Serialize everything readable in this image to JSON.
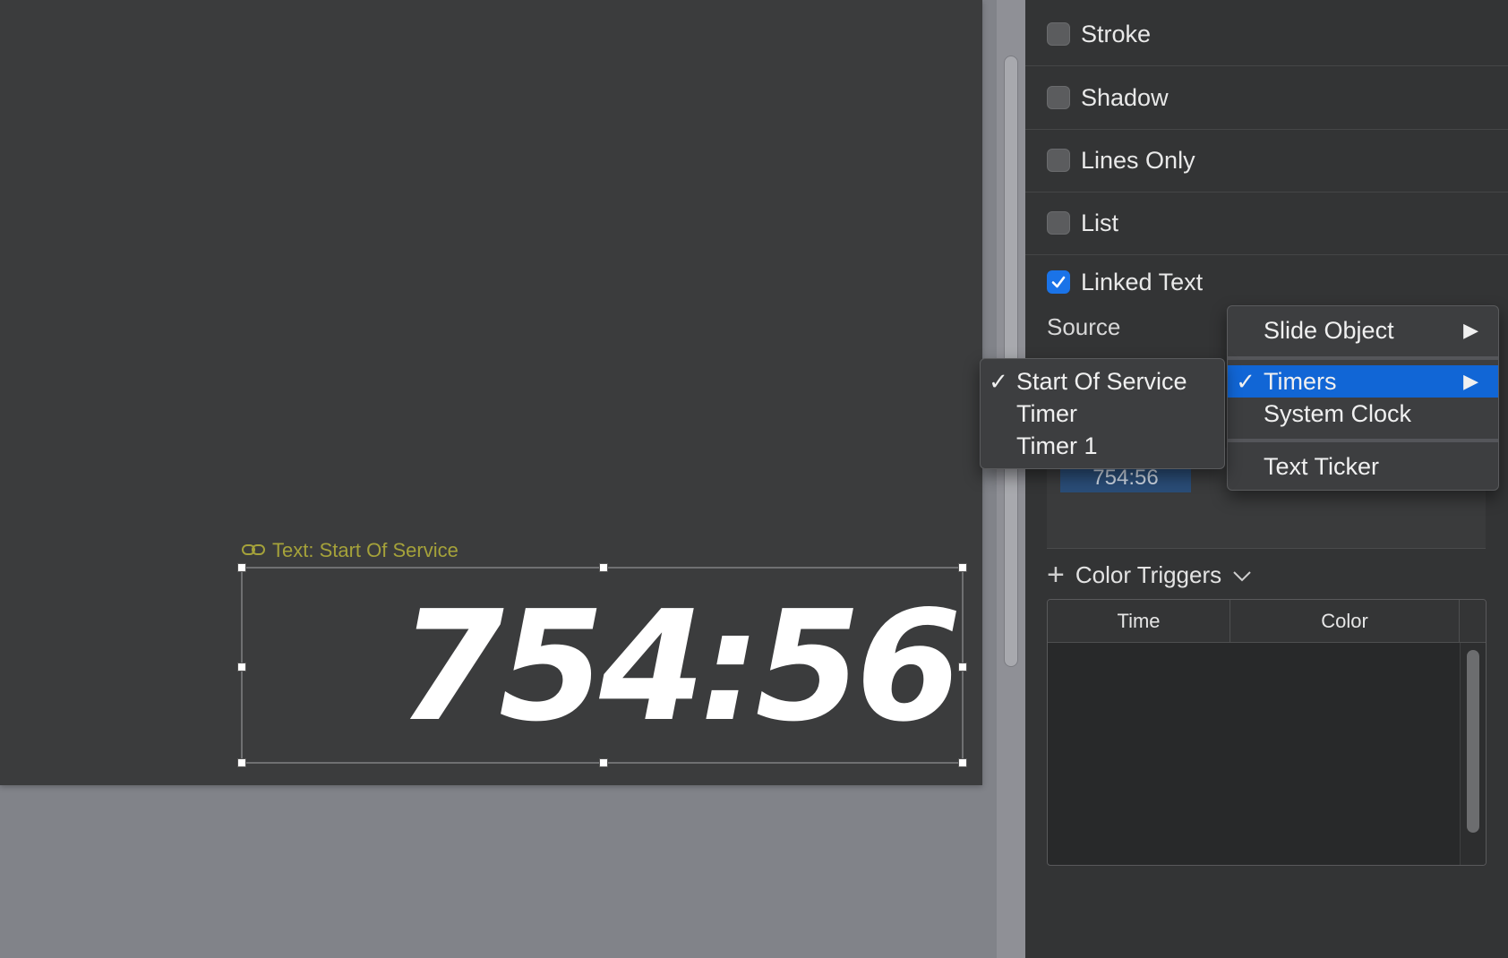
{
  "canvas": {
    "object_label": "Text: Start Of Service",
    "display_text": "754:56"
  },
  "inspector": {
    "options": [
      {
        "label": "Stroke",
        "checked": false
      },
      {
        "label": "Shadow",
        "checked": false
      },
      {
        "label": "Lines Only",
        "checked": false
      },
      {
        "label": "List",
        "checked": false
      },
      {
        "label": "Linked Text",
        "checked": true
      }
    ],
    "source_label": "Source",
    "preview_value": "754:56",
    "color_triggers": {
      "title": "Color Triggers",
      "columns": [
        "Time",
        "Color"
      ]
    }
  },
  "source_menu": {
    "items": [
      {
        "label": "Slide Object",
        "checked": false,
        "submenu": true
      },
      {
        "label": "Timers",
        "checked": true,
        "submenu": true,
        "selected": true
      },
      {
        "label": "System Clock",
        "checked": false,
        "submenu": false
      },
      {
        "label": "Text Ticker",
        "checked": false,
        "submenu": false
      }
    ]
  },
  "timers_submenu": {
    "items": [
      {
        "label": "Start Of Service",
        "checked": true
      },
      {
        "label": "Timer",
        "checked": false
      },
      {
        "label": "Timer 1",
        "checked": false
      }
    ]
  },
  "colors": {
    "accent": "#1166d6",
    "label_yellow": "#a5a23a"
  }
}
